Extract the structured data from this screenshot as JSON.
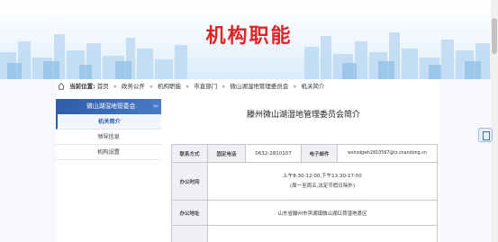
{
  "banner": {
    "title": "机构职能"
  },
  "breadcrumb": {
    "label": "当前位置:",
    "items": [
      "首页",
      "政务公开",
      "机构职能",
      "市直部门",
      "微山湖湿地管理委员会",
      "机关简介"
    ],
    "separator": "»"
  },
  "sidebar": {
    "header": "微山湖湿地管委会",
    "header_icon": "double-chevron-right-icon",
    "items": [
      {
        "label": "机关简介",
        "active": true
      },
      {
        "label": "领导信息",
        "active": false
      },
      {
        "label": "机构设置",
        "active": false
      }
    ]
  },
  "content": {
    "title": "滕州微山湖湿地管理委员会简介",
    "table": {
      "contact_label": "联系方式",
      "phone_label": "固定电话",
      "phone_value": "0632-2810107",
      "email_label": "电子邮件",
      "email_value": "wshsdgwh2810567@tz.shandong.cn",
      "hours_label": "办公时间",
      "hours_line1": "上午8:30-12:00,下午13:30-17:00",
      "hours_line2": "(周一至周五,法定节假日除外)",
      "address_label": "办公地址",
      "address_value": "山东省滕州市滨湖镇微山湖红荷湿地景区"
    }
  },
  "colors": {
    "banner_title": "#e02424",
    "accent": "#2f5da8"
  }
}
